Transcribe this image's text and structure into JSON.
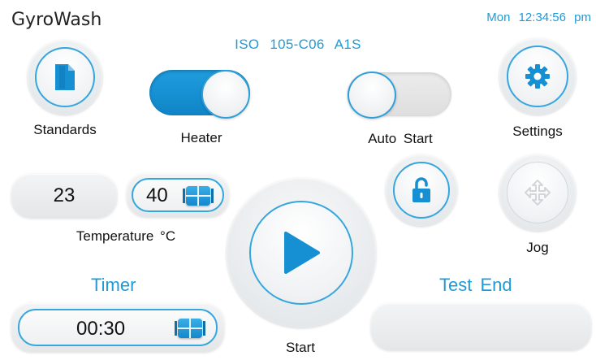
{
  "header": {
    "app_title": "GyroWash",
    "day": "Mon",
    "time": "12:34:56 pm",
    "standard": "ISO  105-C06  A1S"
  },
  "buttons": {
    "standards_label": "Standards",
    "settings_label": "Settings",
    "jog_label": "Jog",
    "start_label": "Start"
  },
  "toggles": {
    "heater": {
      "label": "Heater",
      "state": "on"
    },
    "auto_start": {
      "label": "Auto  Start",
      "state": "off"
    }
  },
  "temperature": {
    "current": "23",
    "setpoint": "40",
    "label": "Temperature  °C"
  },
  "timer": {
    "heading": "Timer",
    "value": "00:30"
  },
  "test_end": {
    "heading": "Test  End",
    "value": ""
  },
  "icons": {
    "standards": "document-icon",
    "settings": "gear-icon",
    "lock": "unlocked-padlock-icon",
    "jog": "move-arrows-icon",
    "start": "play-icon",
    "stepper": "stepper-icon"
  },
  "colors": {
    "accent": "#1e9bd7",
    "toggle_on": "#1f9ee0"
  }
}
